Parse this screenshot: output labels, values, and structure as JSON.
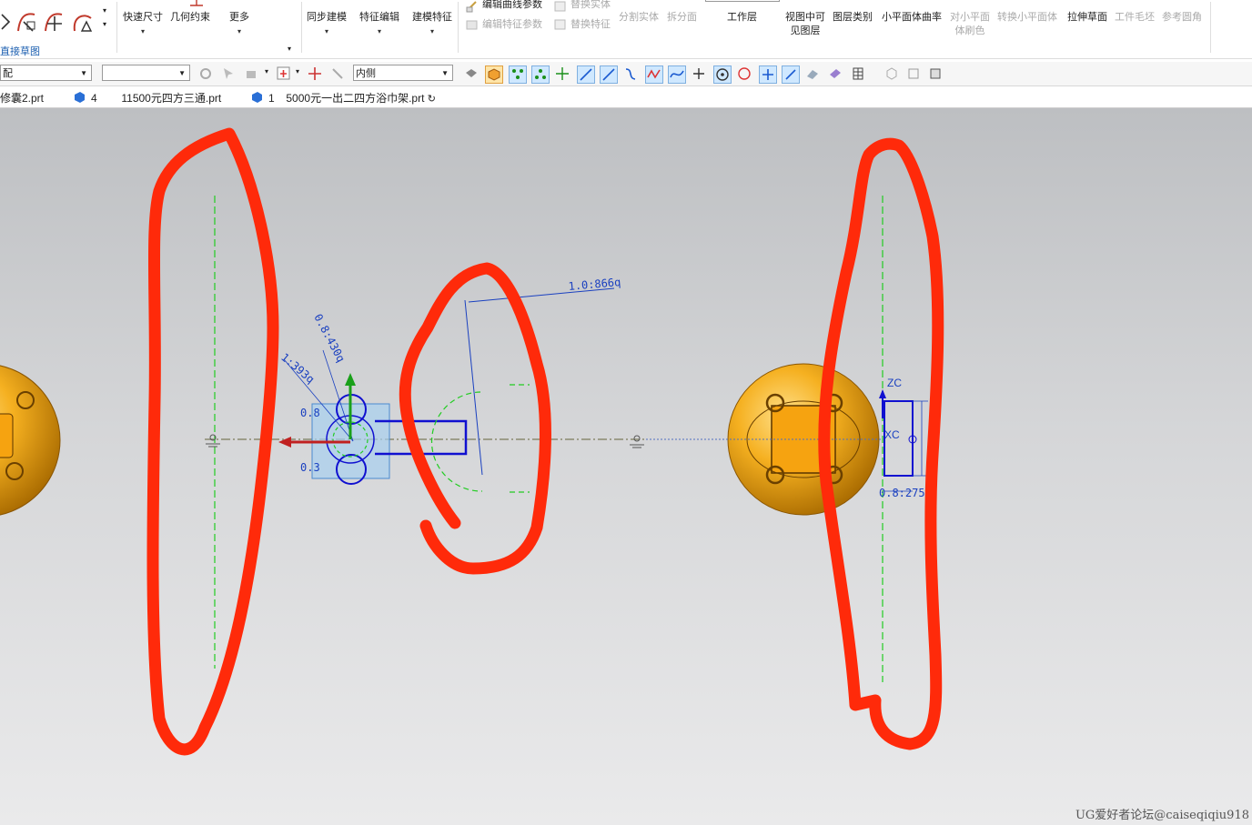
{
  "ribbon": {
    "group_label": "直接草图",
    "quick_dimension": "快速尺寸",
    "geometric_constraint": "几何约束",
    "more": "更多",
    "sync_modeling": "同步建模",
    "feature_edit": "特征编辑",
    "modeling_feature": "建模特征",
    "edit_curve_params": "编辑曲线参数",
    "edit_feature_params": "编辑特征参数",
    "replace_solid": "替换实体",
    "replace_feature": "替换特征",
    "split_body": "分割实体",
    "split_face": "拆分面",
    "work_layer": "工作层",
    "visible_layers_line1": "视图中可",
    "visible_layers_line2": "见图层",
    "layer_category": "图层类别",
    "small_plane_curvature": "小平面体曲率",
    "color_small_plane_line1": "对小平面",
    "color_small_plane_line2": "体刷色",
    "convert_small_plane": "转换小平面体",
    "extrude_sketch": "拉伸草面",
    "workpiece_blank": "工件毛坯",
    "reference_fillet": "参考圆角"
  },
  "toolbar": {
    "filter_value": "配",
    "second_combo_value": "",
    "side_value": "内侧"
  },
  "tabs": [
    {
      "label": "修囊2.prt",
      "prefix": ""
    },
    {
      "label": "11500元四方三通.prt",
      "prefix": "4"
    },
    {
      "label": "5000元一出二四方浴巾架.prt",
      "prefix": "1"
    }
  ],
  "viewport": {
    "dims": {
      "d_right_top": "1.0:866q",
      "d_left_up": "0.8:430q",
      "d_left_mid": "1:393q",
      "d_left_mark1": "0.8",
      "d_left_mark2": "0.3",
      "d_right_bottom": "0.8:275q"
    },
    "axis": {
      "zc": "ZC",
      "xc": "XC"
    }
  },
  "watermark": "UG爱好者论坛@caiseqiqiu918"
}
